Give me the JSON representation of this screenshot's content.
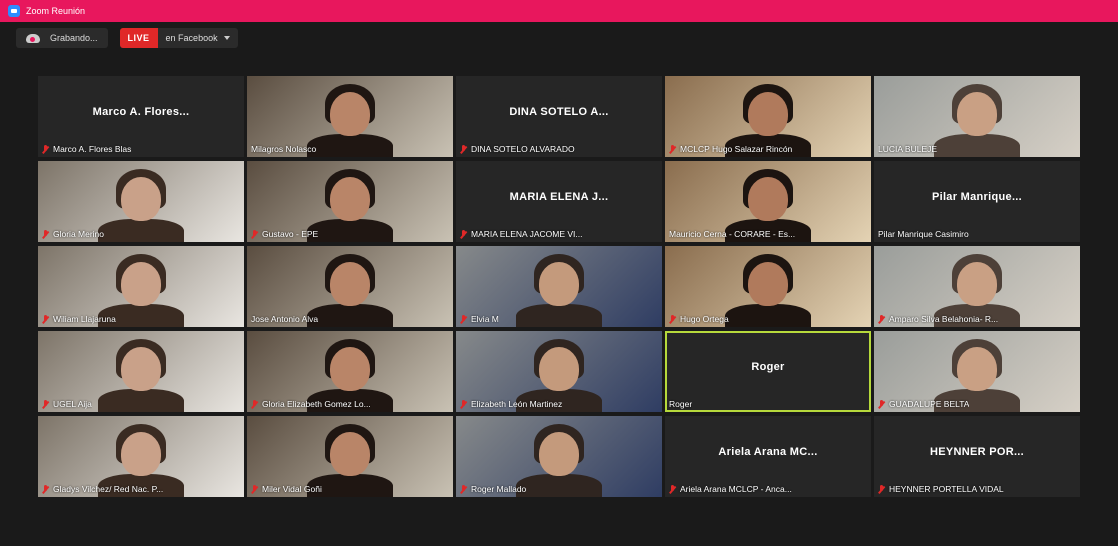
{
  "window": {
    "title": "Zoom Reunión"
  },
  "toolbar": {
    "recording_label": "Grabando...",
    "live_label": "LIVE",
    "live_destination": "en Facebook"
  },
  "participants": [
    {
      "name": "Marco A. Flores Blas",
      "display_center": "Marco A. Flores...",
      "video": false,
      "muted": true
    },
    {
      "name": "Milagros Nolasco",
      "video": true,
      "muted": false
    },
    {
      "name": "DINA SOTELO ALVARADO",
      "display_center": "DINA SOTELO A...",
      "video": false,
      "muted": true
    },
    {
      "name": "MCLCP Hugo Salazar Rincón",
      "video": true,
      "muted": true
    },
    {
      "name": "LUCIA BULEJE",
      "video": true,
      "muted": false
    },
    {
      "name": "Gloria Merino",
      "video": true,
      "muted": true
    },
    {
      "name": "Gustavo - EPE",
      "video": true,
      "muted": true
    },
    {
      "name": "MARIA ELENA JACOME VI...",
      "display_center": "MARIA ELENA J...",
      "video": false,
      "muted": true
    },
    {
      "name": "Mauricio Cerna - CORARE - Es...",
      "video": true,
      "muted": false
    },
    {
      "name": "Pilar Manrique Casimiro",
      "display_center": "Pilar Manrique...",
      "video": false,
      "muted": false
    },
    {
      "name": "Wiliam Llajaruna",
      "video": true,
      "muted": true
    },
    {
      "name": "Jose Antonio Alva",
      "video": true,
      "muted": false
    },
    {
      "name": "Elvia M",
      "video": true,
      "muted": true
    },
    {
      "name": "Hugo Ortega",
      "video": true,
      "muted": true
    },
    {
      "name": "Amparo Silva Belahonia- R...",
      "video": true,
      "muted": true
    },
    {
      "name": "UGEL Aija",
      "video": true,
      "muted": true
    },
    {
      "name": "Gloria Elizabeth Gomez Lo...",
      "video": true,
      "muted": true
    },
    {
      "name": "Elizabeth León Martinez",
      "video": true,
      "muted": true
    },
    {
      "name": "Roger",
      "display_center": "Roger",
      "video": false,
      "muted": false,
      "active_speaker": true
    },
    {
      "name": "GUADALUPE BELTA",
      "video": true,
      "muted": true
    },
    {
      "name": "Gladys Vilchez/ Red Nac. P...",
      "video": true,
      "muted": true
    },
    {
      "name": "Miler Vidal Goñi",
      "video": true,
      "muted": true
    },
    {
      "name": "Roger Mallado",
      "video": true,
      "muted": true
    },
    {
      "name": "Ariela Arana MCLCP - Anca...",
      "display_center": "Ariela Arana MC...",
      "video": false,
      "muted": true
    },
    {
      "name": "HEYNNER PORTELLA VIDAL",
      "display_center": "HEYNNER POR...",
      "video": false,
      "muted": true
    }
  ],
  "colors": {
    "titlebar": "#e8175d",
    "live": "#e02828",
    "active_speaker_border": "#b6d93b",
    "tile_background": "#262626"
  }
}
